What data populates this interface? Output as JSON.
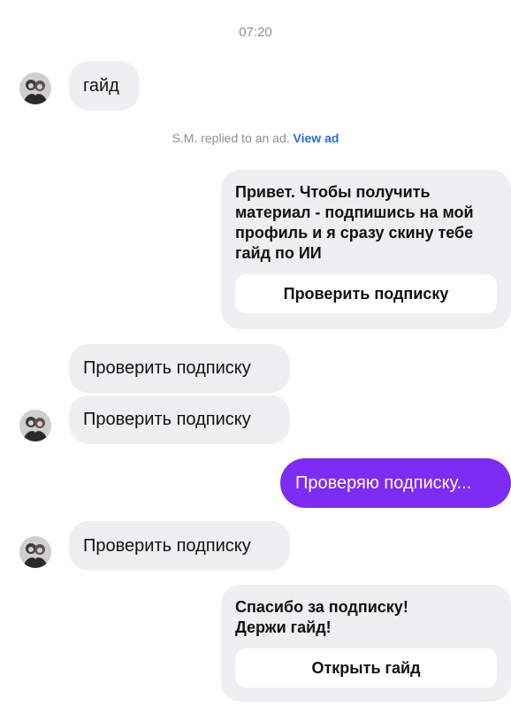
{
  "conversation": {
    "timestamp": "07:20",
    "ad_reply_notice": {
      "text": "S.M. replied to an ad.",
      "link": "View ad"
    },
    "messages": [
      {
        "from": "contact",
        "text": "гайд"
      },
      {
        "from": "me",
        "text": "Привет. Чтобы получить материал - подпишись на мой профиль и я сразу скину тебе гайд по ИИ",
        "button": "Проверить подписку"
      },
      {
        "from": "contact",
        "text": "Проверить подписку"
      },
      {
        "from": "contact",
        "text": "Проверить подписку"
      },
      {
        "from": "me",
        "text": "Проверяю подписку..."
      },
      {
        "from": "contact",
        "text": "Проверить подписку"
      },
      {
        "from": "me",
        "text": "Спасибо за подписку! Держи гайд!",
        "button": "Открыть гайд"
      }
    ]
  },
  "colors": {
    "incoming_bubble": "#efeff2",
    "outgoing_bubble": "#7d2cf3",
    "link": "#2b6dd6",
    "muted_text": "#8e8e93"
  },
  "icons": {
    "avatar": "contact-avatar-photo"
  }
}
